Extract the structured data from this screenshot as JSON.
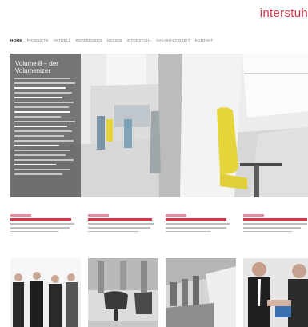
{
  "header": {
    "logo": "interstuh"
  },
  "nav": {
    "items": [
      "HOME",
      "PRODUKTE",
      "AKTUELL",
      "REFERENZEN",
      "DESIGN",
      "INTERSTUHL",
      "NACHHALTIGKEIT",
      "KONTAKT"
    ]
  },
  "hero": {
    "title": "Volume 8 – der Volumenizer"
  },
  "colors": {
    "accent": "#d8344a",
    "chair": "#e5d53a"
  }
}
